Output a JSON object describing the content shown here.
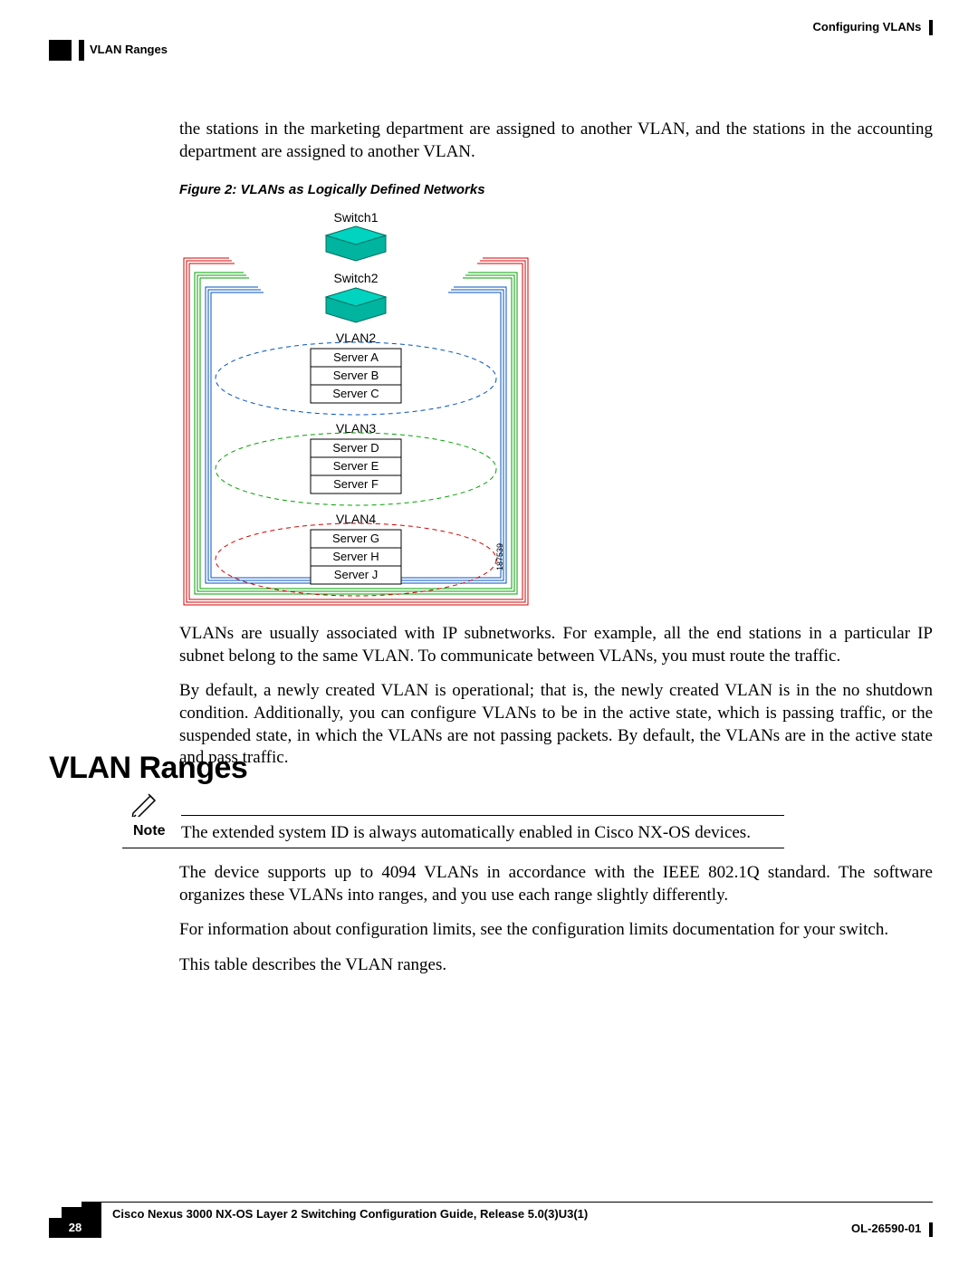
{
  "header": {
    "chapter_title": "Configuring VLANs",
    "section_title": "VLAN Ranges"
  },
  "intro": {
    "p1": "the stations in the marketing department are assigned to another VLAN, and the stations in the accounting department are assigned to another VLAN."
  },
  "figure": {
    "caption": "Figure 2: VLANs as Logically Defined Networks",
    "switch1": "Switch1",
    "switch2": "Switch2",
    "vlan2_label": "VLAN2",
    "vlan2_servers": [
      "Server A",
      "Server B",
      "Server C"
    ],
    "vlan3_label": "VLAN3",
    "vlan3_servers": [
      "Server D",
      "Server E",
      "Server F"
    ],
    "vlan4_label": "VLAN4",
    "vlan4_servers": [
      "Server G",
      "Server H",
      "Server J"
    ],
    "image_id": "187539"
  },
  "after_figure": {
    "p1": "VLANs are usually associated with IP subnetworks. For example, all the end stations in a particular IP subnet belong to the same VLAN. To communicate between VLANs, you must route the traffic.",
    "p2": "By default, a newly created VLAN is operational; that is, the newly created VLAN is in the no shutdown condition. Additionally, you can configure VLANs to be in the active state, which is passing traffic, or the suspended state, in which the VLANs are not passing packets. By default, the VLANs are in the active state and pass traffic."
  },
  "section": {
    "heading": "VLAN Ranges",
    "note_label": "Note",
    "note_text": "The extended system ID is always automatically enabled in Cisco NX-OS devices.",
    "p1": "The device supports up to 4094 VLANs in accordance with the IEEE 802.1Q standard. The software organizes these VLANs into ranges, and you use each range slightly differently.",
    "p2": "For information about configuration limits, see the configuration limits documentation for your switch.",
    "p3": "This table describes the VLAN ranges."
  },
  "footer": {
    "book_title": "Cisco Nexus 3000 NX-OS Layer 2 Switching Configuration Guide, Release 5.0(3)U3(1)",
    "page_number": "28",
    "doc_id": "OL-26590-01"
  }
}
